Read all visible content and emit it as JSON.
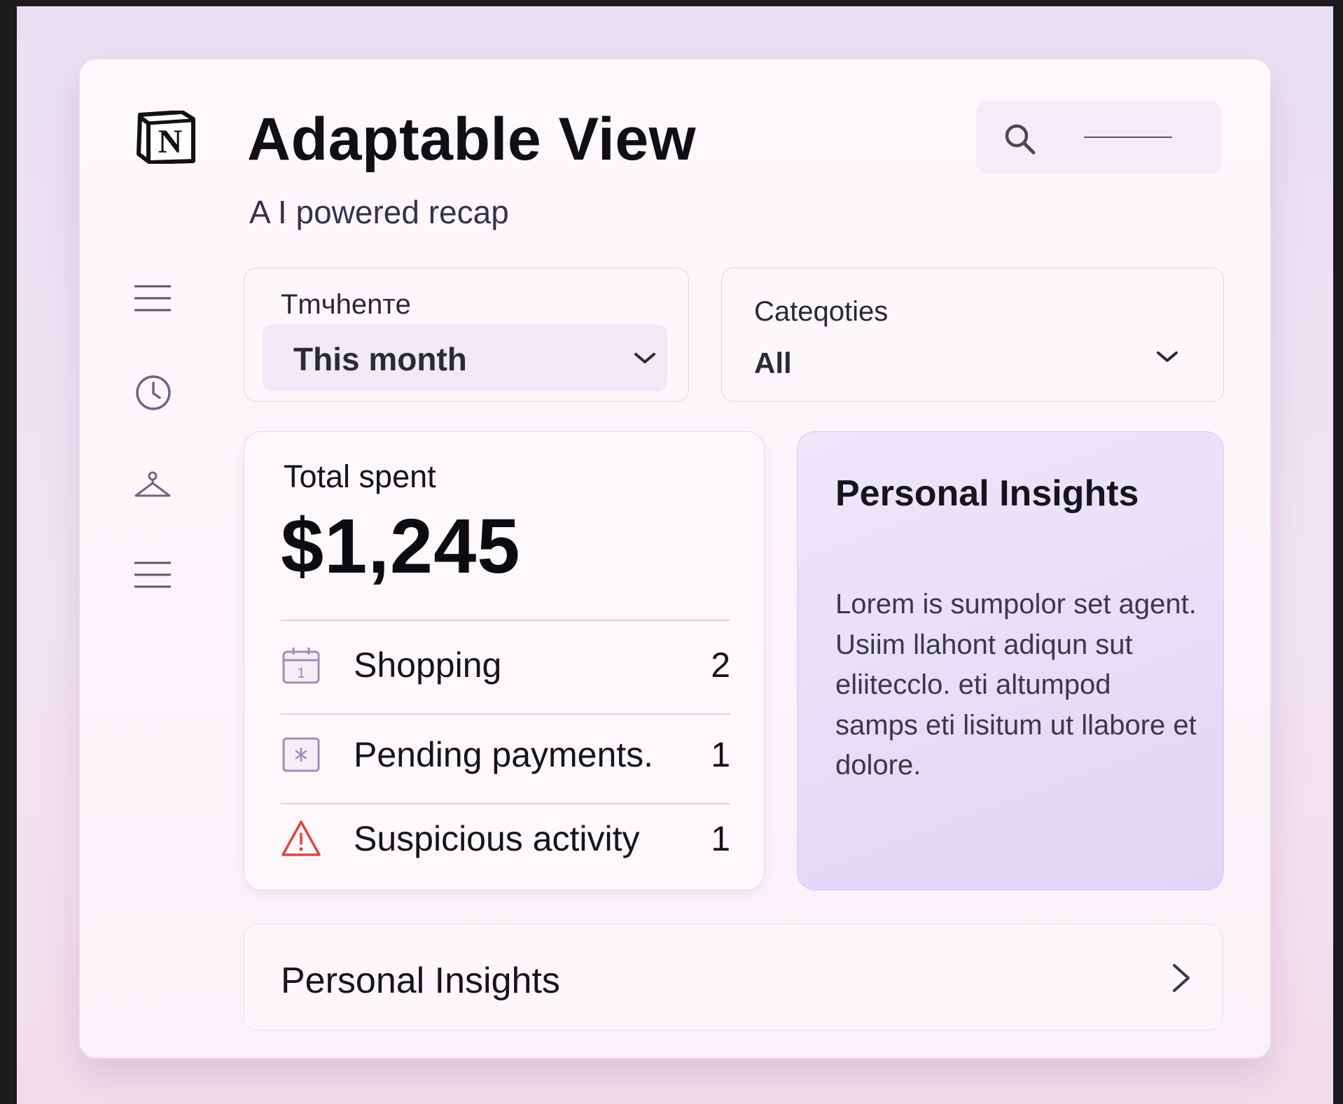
{
  "header": {
    "title": "Adaptable View",
    "subtitle": "A I powered recap",
    "logo_letter": "N"
  },
  "search": {
    "icon": "search-icon"
  },
  "sidebar": {
    "icons": [
      "menu-icon",
      "clock-icon",
      "hanger-icon",
      "list-icon"
    ]
  },
  "filters": {
    "timeframe": {
      "label": "Tmчhenтe",
      "value": "This month"
    },
    "categories": {
      "label": "Cateqoties",
      "value": "All"
    }
  },
  "summary": {
    "label": "Total spent",
    "amount": "$1,245",
    "rows": [
      {
        "label": "Shopping",
        "count": "2",
        "icon": "calendar-icon"
      },
      {
        "label": "Pending payments.",
        "count": "1",
        "icon": "pending-icon"
      },
      {
        "label": "Suspicious activity",
        "count": "1",
        "icon": "warning-icon"
      }
    ]
  },
  "insights": {
    "title": "Personal Insights",
    "body": "Lorem is sumpolor set agent. Usiim llahont adiqun sut eliitecclo. eti altumpod samps eti lisitum ut llabore et dolore."
  },
  "bottom_bar": {
    "label": "Personal Insights",
    "icon": "chevron-right-icon"
  },
  "colors": {
    "accent": "#e2d6f7",
    "warning": "#e0453a",
    "icon_muted": "#8f84b3"
  }
}
